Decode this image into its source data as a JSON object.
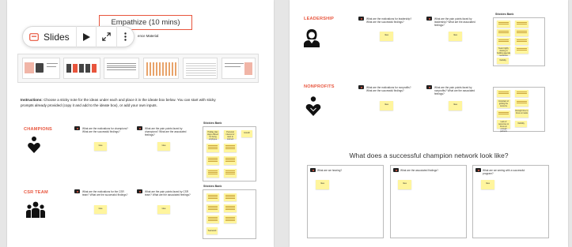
{
  "toolbar": {
    "slides_label": "Slides",
    "play_icon": "play-icon",
    "expand_icon": "expand-icon",
    "more_icon": "more-vertical-icon"
  },
  "left": {
    "banner": "Empathize (10 mins)",
    "reference_partial": "ence Material",
    "instructions_bold": "Instructions:",
    "instructions_text": " Choose a sticky note for the ideas under each and place it in the ideate box below. You can start with sticky prompts already provided (copy it and add to the ideate box), or add your own inputs.",
    "sections": [
      {
        "title": "CHAMPIONS",
        "icon": "heart-person-icon",
        "q1": "What are the motivations for champions? What are the successful findings?",
        "q2": "What are the pain points faced by champions? What are the associated feelings?",
        "bank_title": "Stickies Bank",
        "bank_notes": [
          "Holiday plan stays offered for being employee",
          "Personal interest or want to connect",
          "Growth",
          "",
          "",
          "",
          "",
          "",
          ""
        ]
      },
      {
        "title": "CSR TEAM",
        "icon": "team-icon",
        "q1": "What are the motivations for the CSR team? What are the successful findings?",
        "q2": "What are the pain points faced by CSR team? What are the associated feelings?",
        "bank_title": "Stickies Bank",
        "bank_notes": [
          "",
          "",
          "",
          "",
          "",
          "",
          "",
          "",
          "Teamwork"
        ]
      }
    ],
    "idea_label": "Idea"
  },
  "right": {
    "sections": [
      {
        "title": "LEADERSHIP",
        "icon": "leader-person-icon",
        "q1": "What are the motivations for leadership? What are the successful findings?",
        "q2": "What are the pain points faced by leadership? What are the associated feelings?",
        "bank_title": "Stickies Bank",
        "bank_notes": [
          "",
          "",
          "",
          "",
          "",
          "",
          "",
          "Team highly sharing in building agenda resources",
          "",
          "Visibility"
        ]
      },
      {
        "title": "NONPROFITS",
        "icon": "hand-heart-icon",
        "q1": "What are the motivations for nonprofits? What are the successful findings?",
        "q2": "What are the pain points faced by nonprofits? What are the associated feelings?",
        "bank_title": "",
        "bank_notes": [
          "",
          "",
          "Important of getting the resource",
          "",
          "",
          "Enough time to focus on tasks",
          "Lack of resources to focus on enough partners",
          "Visibility"
        ]
      }
    ],
    "question_title": "What does a successful champion network look like?",
    "boxes": [
      {
        "label": "What are we hearing?"
      },
      {
        "label": "What are the associated findings?"
      },
      {
        "label": "What are we seeing with a successful program?"
      }
    ],
    "idea_label": "Idea"
  },
  "colors": {
    "accent": "#e8553d",
    "sticky": "#fff59d",
    "background": "#e6e6e6"
  }
}
